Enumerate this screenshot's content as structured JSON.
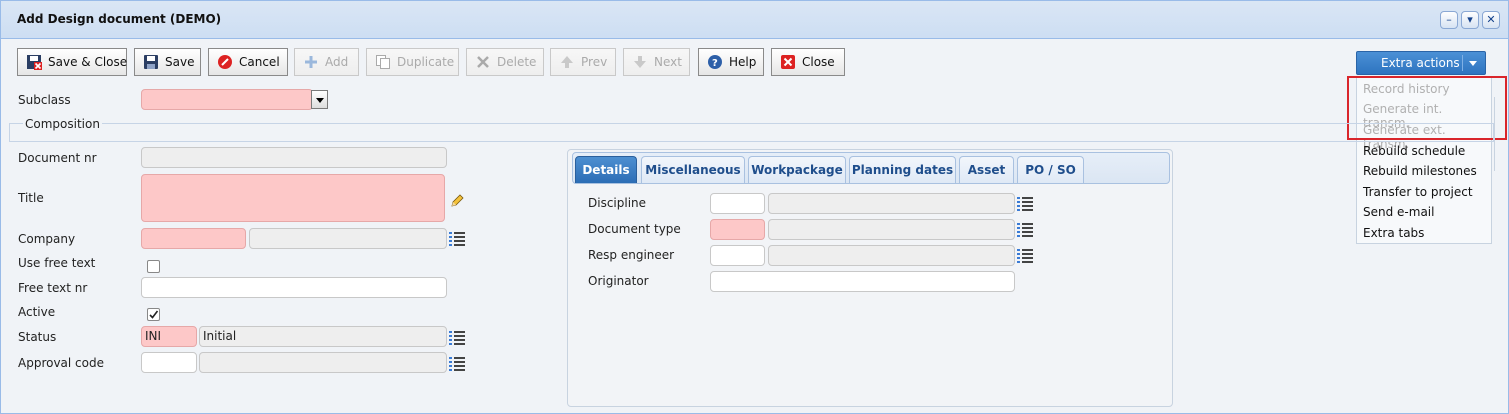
{
  "window": {
    "title": "Add Design document (DEMO)"
  },
  "toolbar": {
    "save_close": "Save & Close",
    "save": "Save",
    "cancel": "Cancel",
    "add": "Add",
    "duplicate": "Duplicate",
    "delete": "Delete",
    "prev": "Prev",
    "next": "Next",
    "help": "Help",
    "close": "Close"
  },
  "extra_actions": {
    "label": "Extra actions",
    "items": [
      {
        "label": "Record history",
        "enabled": false
      },
      {
        "label": "Generate int. transm.",
        "enabled": false
      },
      {
        "label": "Generate ext. transm.",
        "enabled": false
      },
      {
        "label": "Rebuild schedule",
        "enabled": true
      },
      {
        "label": "Rebuild milestones",
        "enabled": true
      },
      {
        "label": "Transfer to project",
        "enabled": true
      },
      {
        "label": "Send e-mail",
        "enabled": true
      },
      {
        "label": "Extra tabs",
        "enabled": true
      }
    ]
  },
  "form": {
    "subclass_label": "Subclass",
    "subclass_value": "",
    "composition_legend": "Composition",
    "document_nr_label": "Document nr",
    "document_nr_value": "",
    "title_label": "Title",
    "title_value": "",
    "company_label": "Company",
    "company_code": "",
    "company_name": "",
    "use_free_text_label": "Use free text",
    "use_free_text_checked": false,
    "free_text_nr_label": "Free text nr",
    "free_text_nr_value": "",
    "active_label": "Active",
    "active_checked": true,
    "status_label": "Status",
    "status_code": "INI",
    "status_name": "Initial",
    "approval_code_label": "Approval code",
    "approval_code_value": "",
    "approval_code_name": ""
  },
  "tabs": [
    "Details",
    "Miscellaneous",
    "Workpackage",
    "Planning dates",
    "Asset",
    "PO / SO"
  ],
  "details": {
    "discipline_label": "Discipline",
    "document_type_label": "Document type",
    "resp_engineer_label": "Resp engineer",
    "originator_label": "Originator"
  },
  "colors": {
    "required_bg": "#fdc8c8",
    "accent": "#2e74c0",
    "highlight_box": "#d9252b"
  }
}
